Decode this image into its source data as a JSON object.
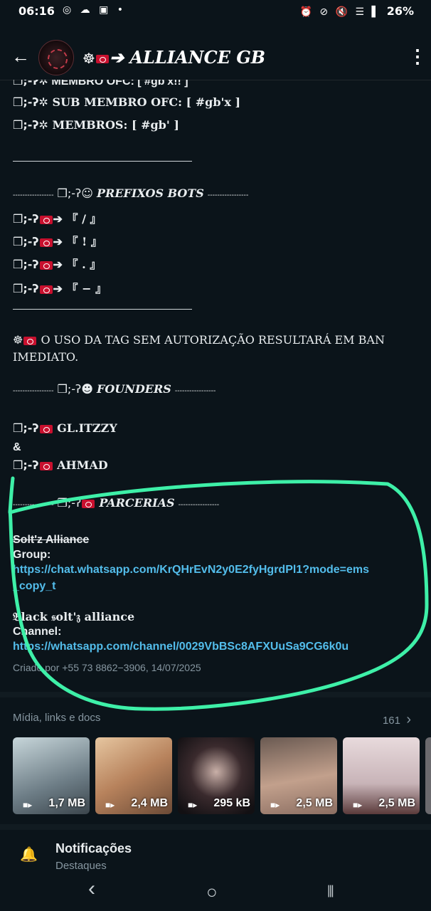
{
  "status_bar": {
    "time": "06:16",
    "left_icons": "◎ ☁ ▣ •",
    "right_icons": "⏰ ⊘ 🔇 ☰ ▌",
    "battery": "26%"
  },
  "header": {
    "title_prefix": "☸",
    "title": "ALLIANCE  GB",
    "back_icon": "←",
    "menu_icon": "⋮"
  },
  "description": {
    "rank_lines": [
      "MEMBRO OFC: [ #gb'x!! ]",
      "SUB MEMBRO OFC: [ #gb'x ]",
      "MEMBROS: [ #gb' ]"
    ],
    "bullet_prefix": "❒;-ʔ",
    "prefix_section_title": "PREFIXOS BOTS",
    "prefix_dashes_left": "-----------------",
    "prefix_dashes_right": "-----------------",
    "prefix_emoji": "☺",
    "bot_prefixes": [
      "『 / 』",
      "『 ! 』",
      "『 . 』",
      "『 − 』"
    ],
    "warning_line1": "O USO DA TAG SEM AUTORIZAÇÃO RESULTARÁ EM BAN",
    "warning_line2": "IMEDIATO.",
    "founders_title": "FOUNDERS",
    "founders_dashes": "-----------------",
    "founders_emoji": "☻",
    "founder1": "GL.ITZZY",
    "and": "&",
    "founder2": "AHMAD",
    "partners_title": "PARCERIAS",
    "partners_dashes": "-----------------",
    "partner1_name": "Solt'z Alliance",
    "partner1_type": "Group:",
    "partner1_link_line1": "https://chat.whatsapp.com/KrQHrEvN2y0E2fyHgrdPl1?mode=ems",
    "partner1_link_line2": "_copy_t",
    "partner2_name": "𝔅lack 𝔰olt'𝔷 alliance",
    "partner2_type": "Channel:",
    "partner2_link": "https://whatsapp.com/channel/0029VbBSc8AFXUuSa9CG6k0u",
    "created_by": "Criado por +55 73 8862−3906, 14/07/2025"
  },
  "media": {
    "title": "Mídia, links e docs",
    "count": "161",
    "chevron": "›",
    "items": [
      {
        "size": "1,7 MB",
        "color": "#9fb3ba"
      },
      {
        "size": "2,4 MB",
        "color": "#c89a78"
      },
      {
        "size": "295 kB",
        "color": "#2a2326"
      },
      {
        "size": "2,5 MB",
        "color": "#a88878"
      },
      {
        "size": "2,5 MB",
        "color": "#d2c2c6"
      }
    ]
  },
  "notifications": {
    "title": "Notificações",
    "subtitle": "Destaques",
    "bell_icon": "🔔"
  },
  "nav": {
    "back": "‹",
    "home": "○",
    "recents": "⦀"
  },
  "colors": {
    "background": "#0b141a",
    "link": "#53bdeb",
    "annotation": "#3ef0a8"
  }
}
